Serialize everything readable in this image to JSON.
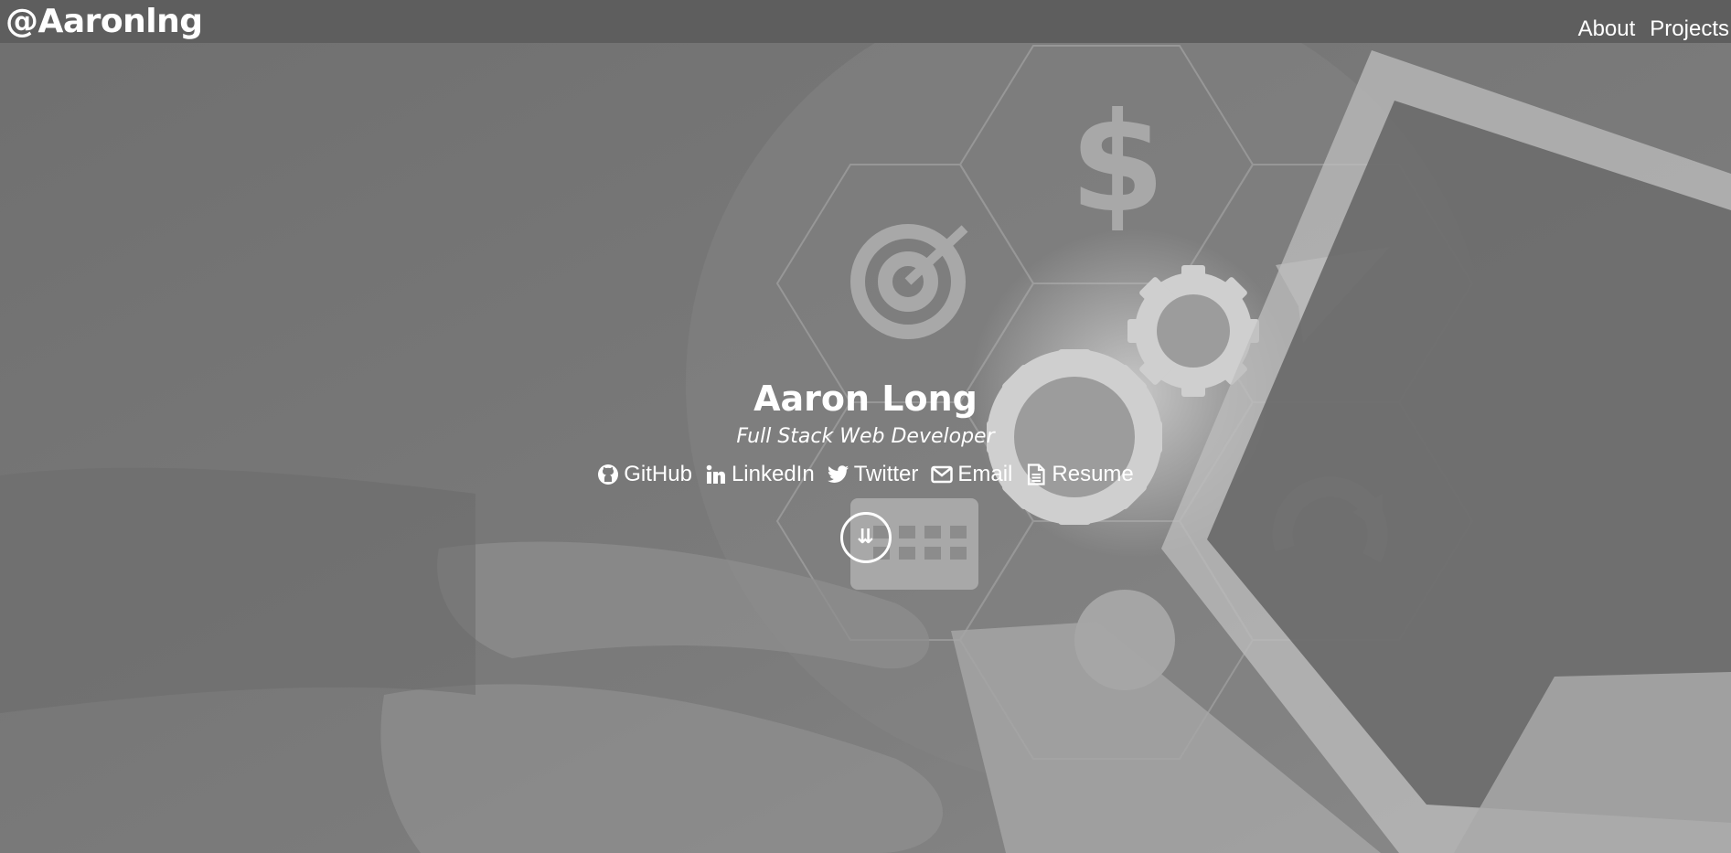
{
  "navbar": {
    "brand": "@Aaronlng",
    "links": [
      {
        "label": "About"
      },
      {
        "label": "Projects"
      }
    ]
  },
  "hero": {
    "name": "Aaron Long",
    "role": "Full Stack Web Developer",
    "social_links": [
      {
        "label": "GitHub",
        "icon": "github-icon"
      },
      {
        "label": "LinkedIn",
        "icon": "linkedin-icon"
      },
      {
        "label": "Twitter",
        "icon": "twitter-icon"
      },
      {
        "label": "Email",
        "icon": "envelope-icon"
      },
      {
        "label": "Resume",
        "icon": "file-icon"
      }
    ],
    "scroll_button_glyph": "⇊",
    "scroll_button_icon": "double-arrow-down-icon"
  },
  "colors": {
    "navbar_bg": "#5e5e5e",
    "hero_overlay": "#7a7a7a",
    "text": "#ffffff"
  }
}
